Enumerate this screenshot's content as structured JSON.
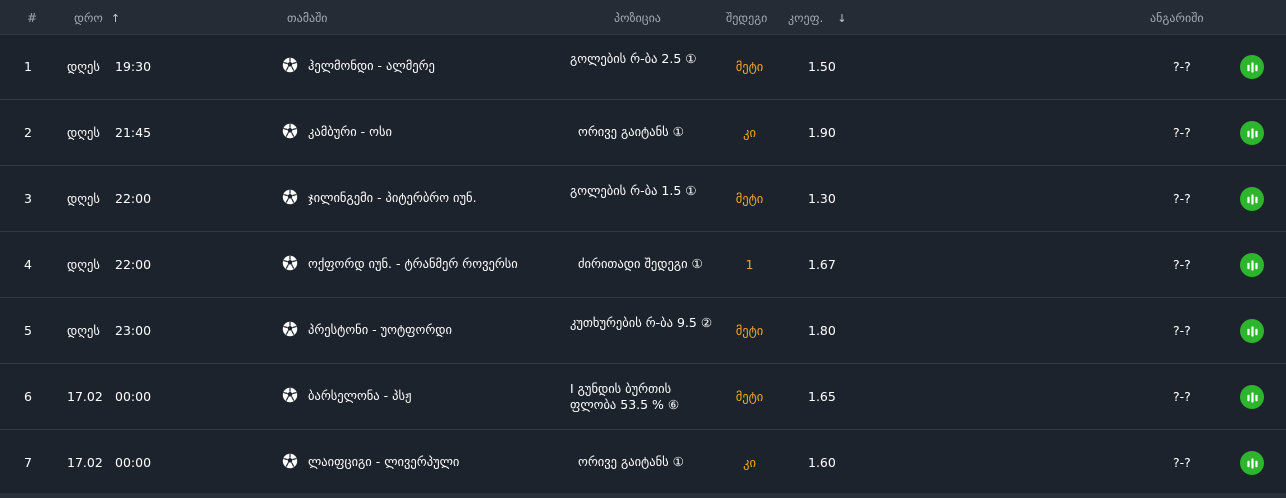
{
  "header": {
    "num": "#",
    "date": "დრო",
    "match": "თამაში",
    "position": "პოზიცია",
    "outcome": "შედეგი",
    "odds": "კოეფ.",
    "result": "ანგარიში"
  },
  "rows": [
    {
      "num": "1",
      "date": "დღეს",
      "time": "19:30",
      "match": "ჰელმონდი - ალმერე",
      "position": "გოლების რ-ბა 2.5 ①",
      "outcome": "მეტი",
      "odds": "1.50",
      "result": "?-?"
    },
    {
      "num": "2",
      "date": "დღეს",
      "time": "21:45",
      "match": "კამბური - ოსი",
      "position": "ორივე გაიტანს ①",
      "outcome": "კი",
      "odds": "1.90",
      "result": "?-?"
    },
    {
      "num": "3",
      "date": "დღეს",
      "time": "22:00",
      "match": "ჯილინგემი - პიტერბრო იუნ.",
      "position": "გოლების რ-ბა 1.5 ①",
      "outcome": "მეტი",
      "odds": "1.30",
      "result": "?-?"
    },
    {
      "num": "4",
      "date": "დღეს",
      "time": "22:00",
      "match": "ოქფორდ იუნ. - ტრანმერ როვერსი",
      "position": "ძირითადი შედეგი ①",
      "outcome": "1",
      "odds": "1.67",
      "result": "?-?"
    },
    {
      "num": "5",
      "date": "დღეს",
      "time": "23:00",
      "match": "პრესტონი - უოტფორდი",
      "position": "კუთხურების რ-ბა 9.5 ②",
      "outcome": "მეტი",
      "odds": "1.80",
      "result": "?-?"
    },
    {
      "num": "6",
      "date": "17.02",
      "time": "00:00",
      "match": "ბარსელონა - პსჟ",
      "position": "I გუნდის ბურთის ფლობა 53.5 % ⑥",
      "outcome": "მეტი",
      "odds": "1.65",
      "result": "?-?"
    },
    {
      "num": "7",
      "date": "17.02",
      "time": "00:00",
      "match": "ლაიფციგი - ლივერპული",
      "position": "ორივე გაიტანს ①",
      "outcome": "კი",
      "odds": "1.60",
      "result": "?-?"
    }
  ],
  "icons": {
    "sport": "soccer-ball-icon",
    "action": "stats-bars-icon",
    "sort_up": "arrow-up-icon",
    "sort_down": "arrow-down-icon"
  },
  "colors": {
    "background": "#1d232c",
    "header": "#262c35",
    "outcome": "#f5a623",
    "action": "#2db52d"
  }
}
